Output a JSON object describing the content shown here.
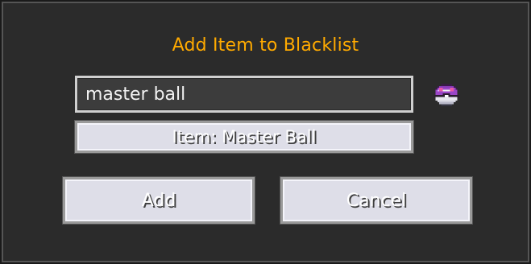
{
  "dialog": {
    "title": "Add Item to Blacklist",
    "search": {
      "value": "master ball",
      "placeholder": ""
    },
    "preview_icon": "master-ball-icon",
    "result_label": "Item: Master Ball",
    "buttons": {
      "add_label": "Add",
      "cancel_label": "Cancel"
    },
    "colors": {
      "title": "#ffaa00",
      "background": "#2b2b2b",
      "button_face": "#dedee8"
    }
  }
}
